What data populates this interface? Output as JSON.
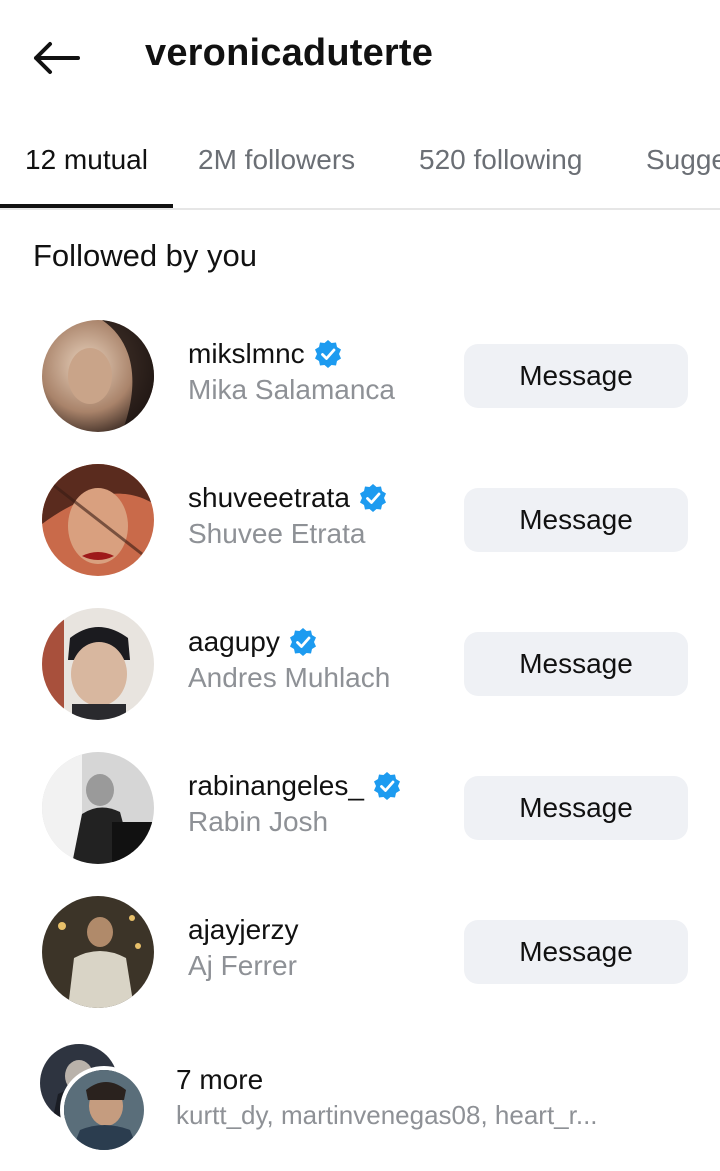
{
  "header": {
    "title": "veronicaduterte",
    "back_icon": "arrow-left-icon"
  },
  "tabs": [
    {
      "label": "12 mutual",
      "active": true
    },
    {
      "label": "2M followers",
      "active": false
    },
    {
      "label": "520 following",
      "active": false
    },
    {
      "label": "Suggested",
      "active": false
    }
  ],
  "section": {
    "title": "Followed by you"
  },
  "rows": [
    {
      "username": "mikslmnc",
      "fullname": "Mika Salamanca",
      "verified": true,
      "button": "Message"
    },
    {
      "username": "shuveeetrata",
      "fullname": "Shuvee Etrata",
      "verified": true,
      "button": "Message"
    },
    {
      "username": "aagupy",
      "fullname": "Andres Muhlach",
      "verified": true,
      "button": "Message"
    },
    {
      "username": "rabinangeles_",
      "fullname": "Rabin Josh",
      "verified": true,
      "button": "Message"
    },
    {
      "username": "ajayjerzy",
      "fullname": "Aj Ferrer",
      "verified": false,
      "button": "Message"
    }
  ],
  "more": {
    "title": "7 more",
    "names": "kurtt_dy, martinvenegas08, heart_r..."
  },
  "colors": {
    "verified_blue": "#1d9bf0",
    "button_bg": "#eff1f5",
    "muted_text": "#8e9196"
  }
}
